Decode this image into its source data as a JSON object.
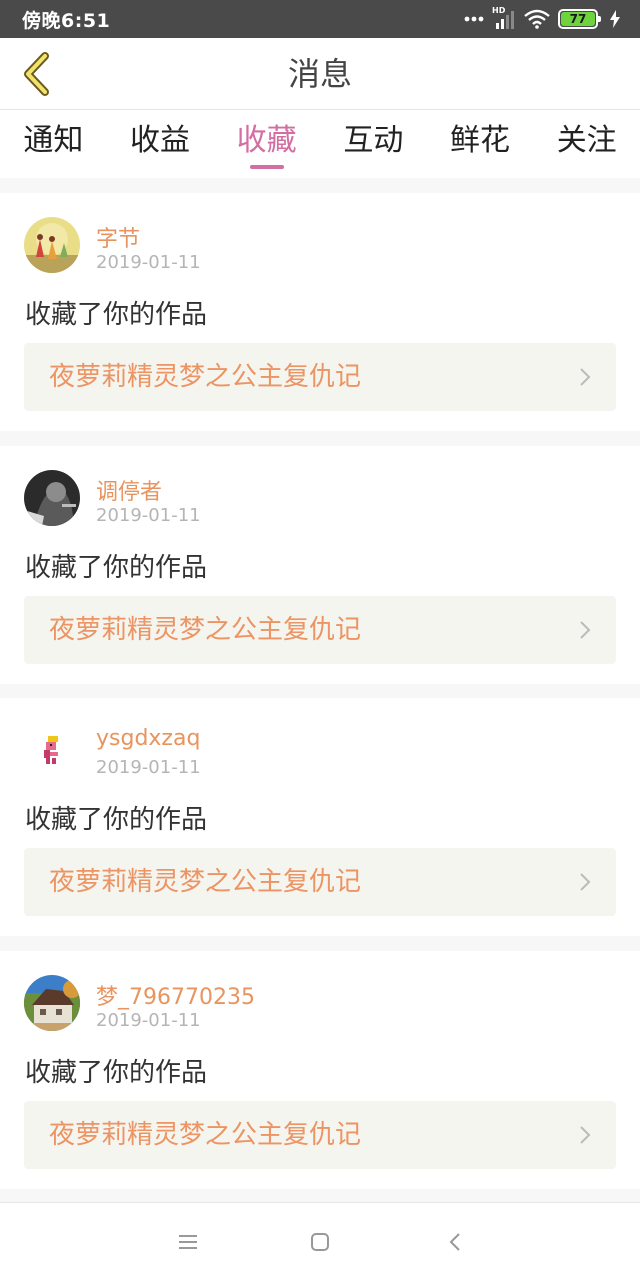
{
  "status_bar": {
    "time": "傍晚6:51",
    "network": "HD",
    "battery": "77"
  },
  "header": {
    "title": "消息"
  },
  "tabs": [
    {
      "label": "通知",
      "active": false
    },
    {
      "label": "收益",
      "active": false
    },
    {
      "label": "收藏",
      "active": true
    },
    {
      "label": "互动",
      "active": false
    },
    {
      "label": "鲜花",
      "active": false
    },
    {
      "label": "关注",
      "active": false
    }
  ],
  "colors": {
    "accent": "#d36ea2",
    "username": "#e8945e",
    "work_title": "#ec9463",
    "work_bg": "#f5f5ef"
  },
  "messages": [
    {
      "username": "字节",
      "date": "2019-01-11",
      "action": "收藏了你的作品",
      "work_title": "夜萝莉精灵梦之公主复仇记",
      "avatar": "painting-avatar"
    },
    {
      "username": "调停者",
      "date": "2019-01-11",
      "action": "收藏了你的作品",
      "work_title": "夜萝莉精灵梦之公主复仇记",
      "avatar": "dark-photo-avatar"
    },
    {
      "username": "ysgdxzaq",
      "date": "2019-01-11",
      "action": "收藏了你的作品",
      "work_title": "夜萝莉精灵梦之公主复仇记",
      "avatar": "pixel-character-avatar"
    },
    {
      "username": "梦_796770235",
      "date": "2019-01-11",
      "action": "收藏了你的作品",
      "work_title": "夜萝莉精灵梦之公主复仇记",
      "avatar": "house-avatar"
    }
  ],
  "nav_bar": {
    "icons": [
      "menu-icon",
      "home-icon",
      "back-icon"
    ]
  }
}
